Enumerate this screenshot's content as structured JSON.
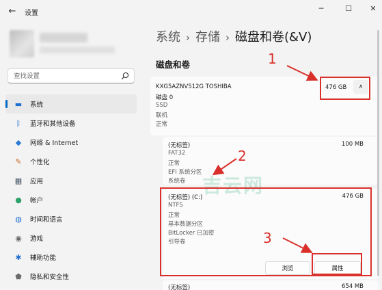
{
  "window": {
    "title": "设置",
    "back_glyph": "←",
    "minimize_glyph": "─",
    "maximize_glyph": "☐",
    "close_glyph": "✕"
  },
  "search": {
    "placeholder": "查找设置"
  },
  "nav": [
    {
      "label": "系统",
      "icon": "monitor-icon",
      "glyph": "▬",
      "color": "#1f6fd1",
      "active": true
    },
    {
      "label": "蓝牙和其他设备",
      "icon": "bluetooth-icon",
      "glyph": "ᛒ",
      "color": "#1f6fd1",
      "active": false
    },
    {
      "label": "网络 & Internet",
      "icon": "wifi-icon",
      "glyph": "◆",
      "color": "#2b7bd6",
      "active": false
    },
    {
      "label": "个性化",
      "icon": "brush-icon",
      "glyph": "✎",
      "color": "#c86a2a",
      "active": false
    },
    {
      "label": "应用",
      "icon": "apps-icon",
      "glyph": "▦",
      "color": "#4a5a6a",
      "active": false
    },
    {
      "label": "帐户",
      "icon": "account-icon",
      "glyph": "●",
      "color": "#2fa36b",
      "active": false
    },
    {
      "label": "时间和语言",
      "icon": "globe-icon",
      "glyph": "◍",
      "color": "#1f6fd1",
      "active": false
    },
    {
      "label": "游戏",
      "icon": "gamepad-icon",
      "glyph": "◉",
      "color": "#6a6a6a",
      "active": false
    },
    {
      "label": "辅助功能",
      "icon": "accessibility-icon",
      "glyph": "✱",
      "color": "#1f6fd1",
      "active": false
    },
    {
      "label": "隐私和安全性",
      "icon": "shield-icon",
      "glyph": "⬟",
      "color": "#6a6a6a",
      "active": false
    }
  ],
  "breadcrumb": {
    "item1": "系统",
    "item2": "存储",
    "current": "磁盘和卷(&V)",
    "sep": "›"
  },
  "section_title": "磁盘和卷",
  "disk": {
    "name": "KXG5AZNV512G TOSHIBA",
    "label": "磁盘 0",
    "type": "SSD",
    "state": "联机",
    "health": "正常",
    "size": "476 GB",
    "collapse_glyph": "∧"
  },
  "partitions": [
    {
      "name": "(无标签)",
      "size": "100 MB",
      "lines": [
        "FAT32",
        "正常",
        "EFI 系统分区",
        "系统卷"
      ]
    },
    {
      "name": "(无标签) (C:)",
      "size": "476 GB",
      "lines": [
        "NTFS",
        "正常",
        "基本数据分区",
        "BitLocker 已加密",
        "引导卷"
      ]
    },
    {
      "name": "(无标签)",
      "size": "654 MB",
      "lines": []
    }
  ],
  "buttons": {
    "browse": "浏览",
    "properties": "属性"
  },
  "annotations": {
    "n1": "1",
    "n2": "2",
    "n3": "3",
    "color": "#d9302b"
  },
  "watermark": "吉云网"
}
